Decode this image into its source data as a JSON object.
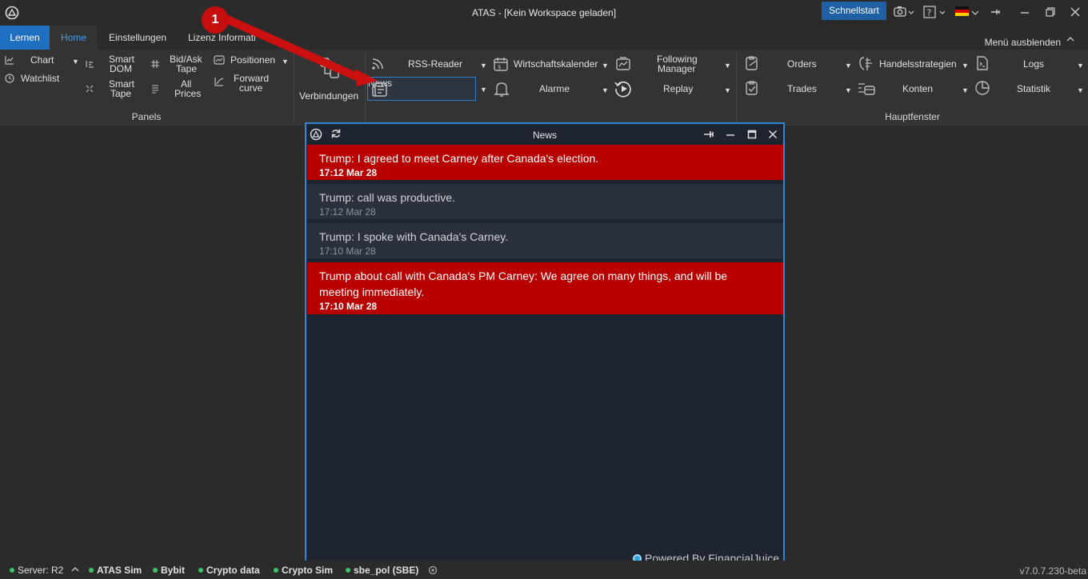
{
  "titlebar": {
    "app_title": "ATAS - [Kein Workspace geladen]",
    "quickstart_label": "Schnellstart",
    "icons": [
      "app-logo-icon",
      "camera-icon",
      "help-icon",
      "german-flag-icon",
      "pin-icon",
      "minimize-icon",
      "restore-icon",
      "close-icon"
    ]
  },
  "tabs": {
    "lernen": "Lernen",
    "home": "Home",
    "einstellungen": "Einstellungen",
    "lizenz": "Lizenz Informati",
    "menu_hide": "Menü ausblenden"
  },
  "ribbon": {
    "panels_group": {
      "label": "Panels",
      "chart": "Chart",
      "watchlist": "Watchlist",
      "smart_dom_1": "Smart",
      "smart_dom_2": "DOM",
      "smart_tape_1": "Smart",
      "smart_tape_2": "Tape",
      "bidask_1": "Bid/Ask",
      "bidask_2": "Tape",
      "allprices_1": "All",
      "allprices_2": "Prices",
      "positionen": "Positionen",
      "forward_1": "Forward",
      "forward_2": "curve"
    },
    "verbindungen": "Verbindungen",
    "tools": {
      "rss": "RSS-Reader",
      "news": "News",
      "kalender": "Wirtschaftskalender",
      "alarme": "Alarme",
      "following_1": "Following",
      "following_2": "Manager",
      "replay": "Replay"
    },
    "hauptfenster_group": {
      "label": "Hauptfenster",
      "orders": "Orders",
      "trades": "Trades",
      "handelsstrategien": "Handelsstrategien",
      "konten": "Konten",
      "logs": "Logs",
      "statistik": "Statistik"
    }
  },
  "news_window": {
    "title": "News",
    "items": [
      {
        "headline": "Trump: I agreed to meet Carney after Canada's election.",
        "time": "17:12 Mar 28",
        "highlight": true
      },
      {
        "headline": "Trump: call was productive.",
        "time": "17:12 Mar 28",
        "highlight": false
      },
      {
        "headline": "Trump: I spoke with Canada's Carney.",
        "time": "17:10 Mar 28",
        "highlight": false
      },
      {
        "headline": "Trump about call with Canada's PM Carney: We agree on many things, and will be meeting immediately.",
        "time": "17:10 Mar 28",
        "highlight": true
      }
    ],
    "powered_by": "Powered By FinancialJuice"
  },
  "annotation": {
    "number": "1"
  },
  "statusbar": {
    "server": "Server: R2",
    "connections": [
      "ATAS Sim",
      "Bybit",
      "Crypto data",
      "Crypto Sim",
      "sbe_pol (SBE)"
    ],
    "version": "v7.0.7.230-beta"
  },
  "colors": {
    "accent": "#1e6fc0",
    "highlight_news": "#b80000",
    "window_border": "#2e86d6",
    "status_green": "#3ec46b"
  }
}
